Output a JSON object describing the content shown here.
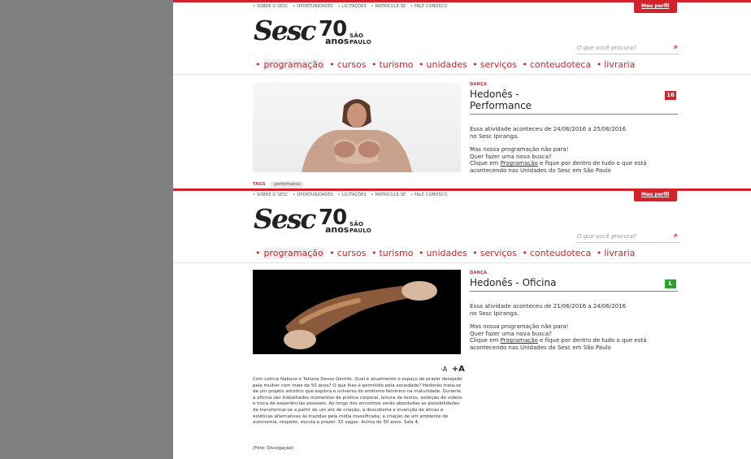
{
  "top_links": [
    "SOBRE O SESC",
    "OPORTUNIDADES",
    "LICITAÇÕES",
    "MATRICULE-SE",
    "FALE CONOSCO"
  ],
  "profile_button": "Meu perfil",
  "logo": {
    "brand": "Sesc",
    "number": "70",
    "anos": "anos",
    "city": "SÃO PAULO"
  },
  "search": {
    "placeholder": "O que você procura?"
  },
  "nav": [
    "programação",
    "cursos",
    "turismo",
    "unidades",
    "serviços",
    "conteudoteca",
    "livraria"
  ],
  "events": [
    {
      "category": "DANÇA",
      "title_line1": "Hedonês -",
      "title_line2": "Performance",
      "rating": "16",
      "info_dates": "Essa atividade aconteceu de 24/06/2016 a 25/06/2016",
      "info_unit": "no Sesc Ipiranga.",
      "msg_line1": "Mas nossa programação não para!",
      "msg_line2": "Quer fazer uma nova busca?",
      "msg_click": "Clique em",
      "msg_link": "Programação",
      "msg_rest": "e fique por dentro de tudo o que está",
      "msg_line4": "acontecendo nas Unidades do Sesc em São Paulo",
      "tags_label": "TAGS",
      "tag": "performance"
    },
    {
      "category": "DANÇA",
      "title_line1": "Hedonês - Oficina",
      "rating": "L",
      "info_dates": "Essa atividade aconteceu de 21/06/2016 a 24/06/2016",
      "info_unit": "no Sesc Ipiranga.",
      "msg_line1": "Mas nossa programação não para!",
      "msg_line2": "Quer fazer uma nova busca?",
      "msg_click": "Clique em",
      "msg_link": "Programação",
      "msg_rest": "e fique por dentro de tudo o que está",
      "msg_line4": "acontecendo nas Unidades do Sesc em São Paulo",
      "font_minus": "-A",
      "font_plus": "+A",
      "description": "Com Letícia Nabuco e Tatiana Devos Gentile. Qual é atualmente o espaço de prazer desejado pela mulher com mais de 50 anos? O que lhes é permitido pela sociedade? Hedonês trata-se de um projeto artístico que explora o universo do erotismo feminino na maturidade. Durante a oficina são trabalhados momentos de prática corporal, leitura de textos, exibição de vídeos e troca de experiências pessoais. Ao longo dos encontros serão abordadas as possibilidades de transformar-se a partir de um ato de criação, a descoberta e invenção de éticas e estéticas alternativas às trazidas pela mídia massificada; a criação de um ambiente de autonomia, respeito, escuta e prazer. 15 vagas. Acima de 50 anos. Sala 4.",
      "credit": "(Foto: Divulgação)"
    }
  ],
  "colors": {
    "brand_red": "#d2232a",
    "rating_16": "#d2232a",
    "rating_L": "#2e9e2e",
    "side_gray": "#7f7f7f"
  }
}
